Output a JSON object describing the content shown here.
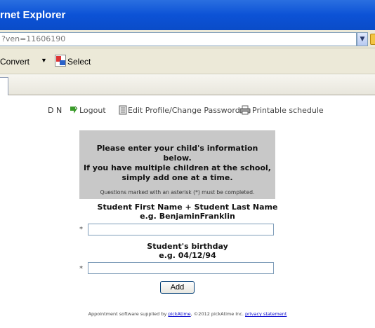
{
  "window": {
    "title": "rnet Explorer"
  },
  "address_bar": {
    "url": "?ven=11606190"
  },
  "toolbar": {
    "convert_label": "Convert",
    "convert_caret": "▼",
    "select_label": "Select"
  },
  "topnav": {
    "user": "D N",
    "logout": "Logout",
    "edit_profile": "Edit Profile/Change Password",
    "printable": "Printable schedule"
  },
  "info": {
    "line1": "Please enter your child's information",
    "line2": "below.",
    "line3": "If you have multiple children at the school,",
    "line4": "simply add one at a time.",
    "note": "Questions marked with an asterisk (*) must be completed."
  },
  "form": {
    "name_label_1": "Student First Name + Student Last Name",
    "name_label_2": "e.g. BenjaminFranklin",
    "name_value": "",
    "birthday_label_1": "Student's birthday",
    "birthday_label_2": "e.g. 04/12/94",
    "birthday_value": "",
    "required_marker": "*",
    "add_button": "Add"
  },
  "footer": {
    "prefix": "Appointment software supplied by ",
    "link_pickatime": "pickAtime",
    "middle": ", ©2012 pickAtime Inc. ",
    "link_privacy": "privacy statement"
  },
  "colors": {
    "titlebar": "#0c52d6",
    "info_box": "#c8c8c8",
    "link": "#0000cc"
  }
}
